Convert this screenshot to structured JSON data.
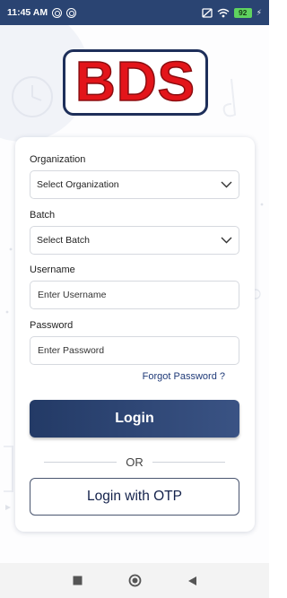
{
  "status_bar": {
    "time": "11:45 AM",
    "battery": "92"
  },
  "logo": {
    "text": "BDS"
  },
  "form": {
    "organization": {
      "label": "Organization",
      "value": "Select Organization"
    },
    "batch": {
      "label": "Batch",
      "value": "Select Batch"
    },
    "username": {
      "label": "Username",
      "placeholder": "Enter Username"
    },
    "password": {
      "label": "Password",
      "placeholder": "Enter Password"
    },
    "forgot_password": "Forgot Password ?",
    "login_label": "Login",
    "or_label": "OR",
    "otp_label": "Login with OTP"
  },
  "colors": {
    "primary": "#233a66",
    "status_bar": "#2a4472",
    "logo_red": "#e3151a",
    "link": "#1f3a78"
  },
  "icons": {
    "dropdown": "chevron-down-icon",
    "nav": [
      "square-icon",
      "circle-icon",
      "back-triangle-icon"
    ]
  }
}
